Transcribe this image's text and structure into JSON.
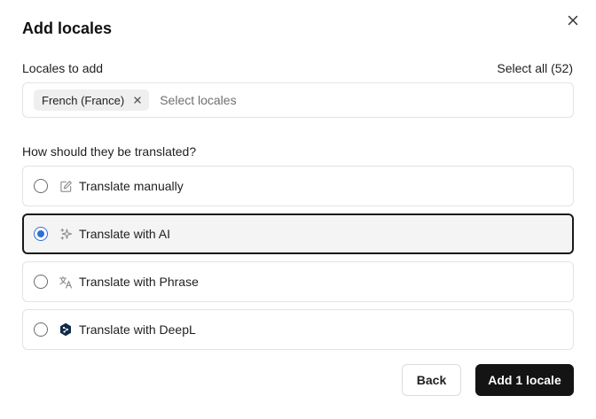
{
  "dialog": {
    "title": "Add locales",
    "close_icon": "close-icon"
  },
  "locales": {
    "label": "Locales to add",
    "select_all": "Select all (52)",
    "chips": [
      {
        "label": "French (France)",
        "remove_icon": "close-icon"
      }
    ],
    "placeholder": "Select locales"
  },
  "translation": {
    "question": "How should they be translated?",
    "selected_index": 1,
    "options": [
      {
        "label": "Translate manually",
        "icon": "pencil-edit-icon",
        "selected": false
      },
      {
        "label": "Translate with AI",
        "icon": "sparkles-icon",
        "selected": true
      },
      {
        "label": "Translate with Phrase",
        "icon": "translate-icon",
        "selected": false
      },
      {
        "label": "Translate with DeepL",
        "icon": "deepl-logo-icon",
        "selected": false
      }
    ]
  },
  "footer": {
    "back_label": "Back",
    "submit_label": "Add 1 locale"
  },
  "colors": {
    "accent_radio": "#2f6fd6",
    "primary_button": "#141414",
    "selected_border": "#1a1a1a"
  }
}
